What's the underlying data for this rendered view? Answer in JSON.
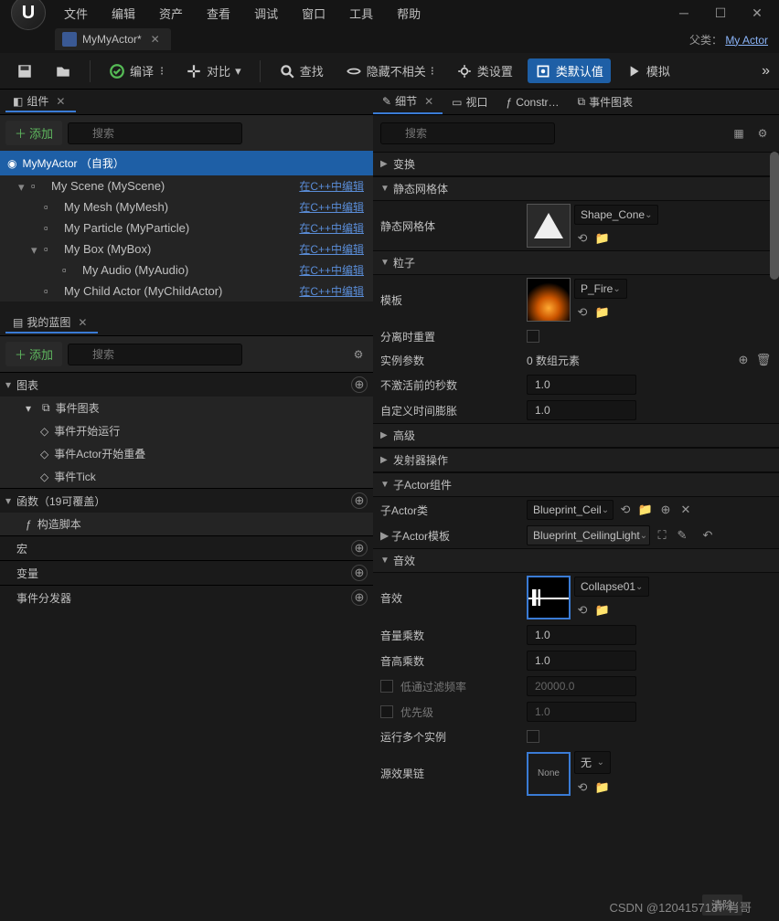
{
  "menu": [
    "文件",
    "编辑",
    "资产",
    "查看",
    "调试",
    "窗口",
    "工具",
    "帮助"
  ],
  "tab": {
    "title": "MyMyActor*",
    "parent_label": "父类：",
    "parent_class": "My Actor"
  },
  "toolbar": {
    "compile": "编译",
    "diff": "对比",
    "find": "查找",
    "hide": "隐藏不相关",
    "class_settings": "类设置",
    "class_defaults": "类默认值",
    "simulate": "模拟"
  },
  "components_panel": {
    "title": "组件",
    "add": "添加",
    "search": "搜索",
    "actor": "MyMyActor （自我）",
    "edit_label": "在C++中编辑",
    "tree": [
      {
        "label": "My Scene (MyScene)",
        "indent": 0,
        "icon": "scene"
      },
      {
        "label": "My Mesh (MyMesh)",
        "indent": 1,
        "icon": "mesh"
      },
      {
        "label": "My Particle (MyParticle)",
        "indent": 1,
        "icon": "particle"
      },
      {
        "label": "My Box (MyBox)",
        "indent": 1,
        "icon": "box"
      },
      {
        "label": "My Audio (MyAudio)",
        "indent": 2,
        "icon": "audio"
      },
      {
        "label": "My Child Actor (MyChildActor)",
        "indent": 1,
        "icon": "child"
      }
    ]
  },
  "blueprint_panel": {
    "title": "我的蓝图",
    "add": "添加",
    "search": "搜索",
    "cats": {
      "graphs": "图表",
      "event_graph": "事件图表",
      "events": [
        "事件开始运行",
        "事件Actor开始重叠",
        "事件Tick"
      ],
      "funcs": "函数（19可覆盖）",
      "construct": "构造脚本",
      "macros": "宏",
      "vars": "变量",
      "dispatchers": "事件分发器"
    }
  },
  "details": {
    "tabs": {
      "details": "细节",
      "viewport": "视口",
      "construct": "Constr…",
      "event_graph": "事件图表"
    },
    "search": "搜索",
    "cats": {
      "transform": "变换",
      "static_mesh": "静态网格体",
      "particle": "粒子",
      "advanced": "高级",
      "emitter": "发射器操作",
      "child_actor": "子Actor组件",
      "child_actor_template": "子Actor模板",
      "sound": "音效"
    },
    "props": {
      "static_mesh": "静态网格体",
      "static_mesh_val": "Shape_Cone",
      "template": "模板",
      "template_val": "P_Fire",
      "reset_on_detach": "分离时重置",
      "instance_params": "实例参数",
      "instance_params_val": "0 数组元素",
      "seconds_before": "不激活前的秒数",
      "seconds_before_val": "1.0",
      "custom_dilation": "自定义时间膨胀",
      "custom_dilation_val": "1.0",
      "child_actor_class": "子Actor类",
      "child_actor_class_val": "Blueprint_Ceil",
      "child_actor_template_val": "Blueprint_CeilingLight",
      "sound": "音效",
      "sound_val": "Collapse01",
      "volume": "音量乘数",
      "volume_val": "1.0",
      "pitch": "音高乘数",
      "pitch_val": "1.0",
      "lowpass": "低通过滤频率",
      "lowpass_val": "20000.0",
      "priority": "优先级",
      "priority_val": "1.0",
      "multiple": "运行多个实例",
      "source_chain": "源效果链",
      "none": "无",
      "none_thumb": "None"
    }
  },
  "footer": {
    "watermark": "CSDN @1204157137 肖哥",
    "clear": "清除"
  }
}
